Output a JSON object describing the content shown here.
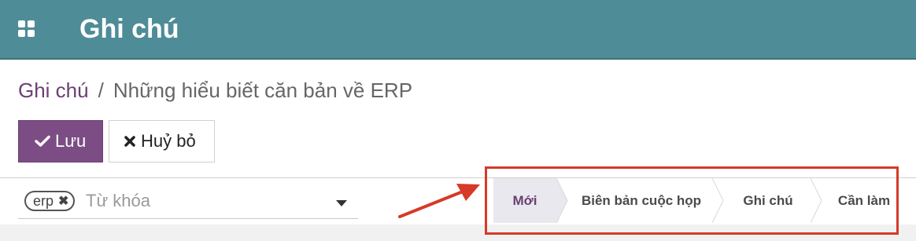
{
  "header": {
    "app_title": "Ghi chú"
  },
  "breadcrumb": {
    "parent": "Ghi chú",
    "separator": "/",
    "current": "Những hiểu biết căn bản về ERP"
  },
  "toolbar": {
    "save_label": "Lưu",
    "cancel_label": "Huỷ bỏ"
  },
  "search": {
    "tag_label": "erp",
    "placeholder": "Từ khóa"
  },
  "stages": [
    {
      "label": "Mới",
      "active": true
    },
    {
      "label": "Biên bản cuộc họp",
      "active": false
    },
    {
      "label": "Ghi chú",
      "active": false
    },
    {
      "label": "Cần làm",
      "active": false
    }
  ],
  "colors": {
    "topbar": "#4e8c97",
    "primary": "#7c4d84",
    "highlight": "#d63a28"
  },
  "icons": {
    "apps": "grid-icon",
    "save": "check-icon",
    "cancel": "times-icon"
  }
}
